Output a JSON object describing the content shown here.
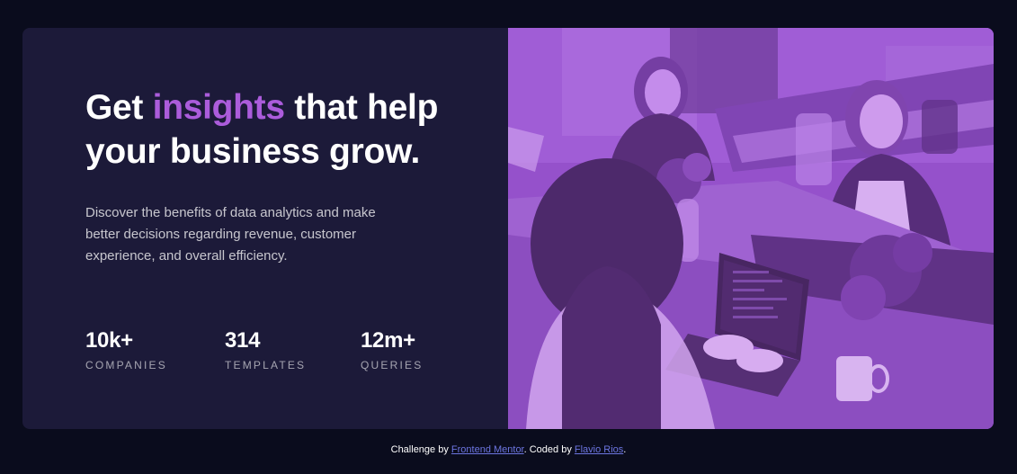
{
  "hero": {
    "headline_part1": "Get ",
    "headline_accent": "insights",
    "headline_part2": " that help your business grow.",
    "description": "Discover the benefits of data analytics and make better decisions regarding revenue, customer experience, and overall efficiency."
  },
  "stats": [
    {
      "value": "10k+",
      "label": "COMPANIES"
    },
    {
      "value": "314",
      "label": "TEMPLATES"
    },
    {
      "value": "12m+",
      "label": "QUERIES"
    }
  ],
  "image": {
    "description_icon": "office-team-photo"
  },
  "attribution": {
    "prefix": "Challenge by ",
    "challenge_link": "Frontend Mentor",
    "middle": ". Coded by ",
    "author_link": "Flavio Rios",
    "suffix": "."
  },
  "colors": {
    "page_bg": "#0a0c1d",
    "card_bg": "#1c1a39",
    "accent": "#ab5cdb",
    "image_tint": "#aa5cdb",
    "link": "#6c75e0"
  }
}
